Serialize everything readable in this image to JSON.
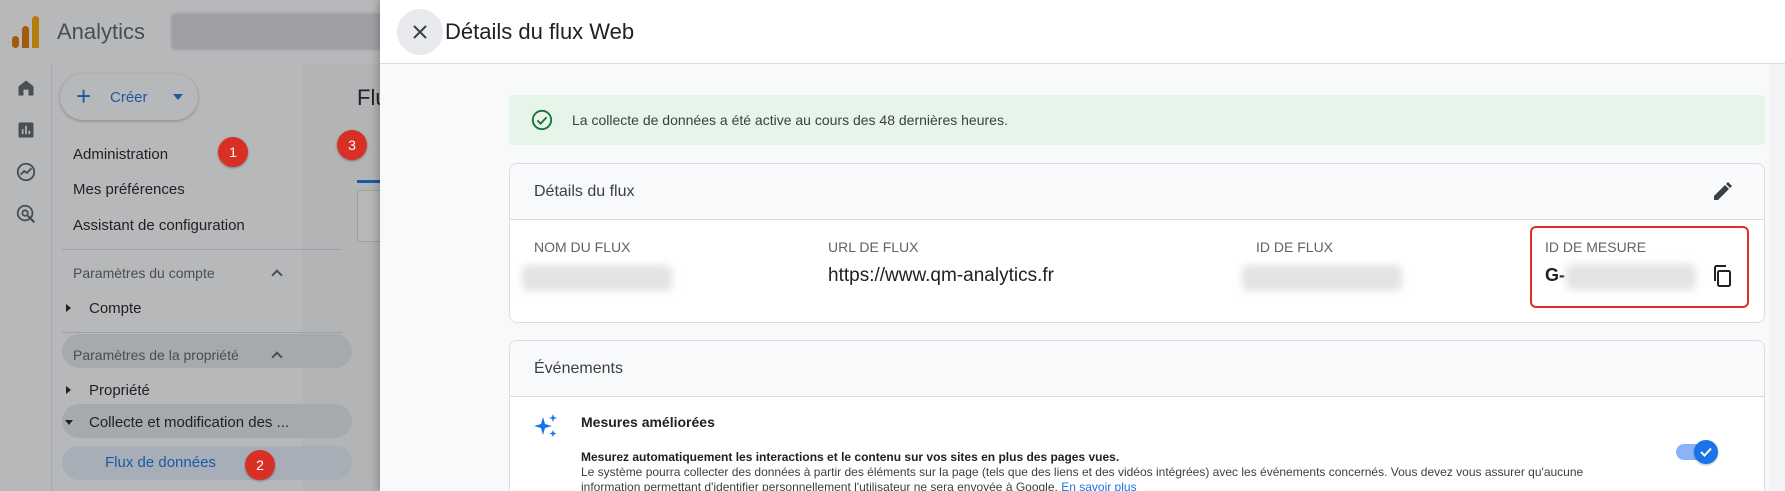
{
  "app": {
    "title": "Analytics",
    "brand_colors": [
      "#f9ab00",
      "#e37400"
    ],
    "create_button": {
      "label": "Créer",
      "icon": "plus-icon"
    },
    "rail_icons": [
      "home-icon",
      "reports-icon",
      "explore-icon",
      "advertising-icon"
    ],
    "nav": {
      "items": [
        "Administration",
        "Mes préférences",
        "Assistant de configuration"
      ],
      "account_section": {
        "label": "Paramètres du compte",
        "children": [
          "Compte"
        ]
      },
      "property_section": {
        "label": "Paramètres de la propriété",
        "children": [
          "Propriété",
          "Collecte et modification des ..."
        ],
        "active_child": "Flux de données"
      }
    },
    "main_title_partial": "Flu"
  },
  "badges": [
    "1",
    "2",
    "3"
  ],
  "panel": {
    "title": "Détails du flux Web",
    "close_icon": "close-icon",
    "status": {
      "icon": "check-circle-icon",
      "text": "La collecte de données a été active au cours des 48 dernières heures."
    },
    "stream_details": {
      "title": "Détails du flux",
      "edit_icon": "pencil-icon",
      "fields": {
        "stream_name": {
          "label": "NOM DU FLUX",
          "value": ""
        },
        "stream_url": {
          "label": "URL DE FLUX",
          "value": "https://www.qm-analytics.fr"
        },
        "stream_id": {
          "label": "ID DE FLUX",
          "value": ""
        },
        "measurement_id": {
          "label": "ID DE MESURE",
          "value_prefix": "G-",
          "copy_icon": "copy-icon"
        }
      }
    },
    "events": {
      "title": "Événements",
      "enhanced": {
        "icon": "sparkle-icon",
        "title": "Mesures améliorées",
        "desc_bold": "Mesurez automatiquement les interactions et le contenu sur vos sites en plus des pages vues.",
        "desc_line1": "Le système pourra collecter des données à partir des éléments sur la page (tels que des liens et des vidéos intégrées) avec les événements concernés. Vous devez vous assurer qu'aucune",
        "desc_line2": "information permettant d'identifier personnellement l'utilisateur ne sera envoyée à Google.",
        "link": "En savoir plus",
        "toggle_on": true
      }
    }
  }
}
